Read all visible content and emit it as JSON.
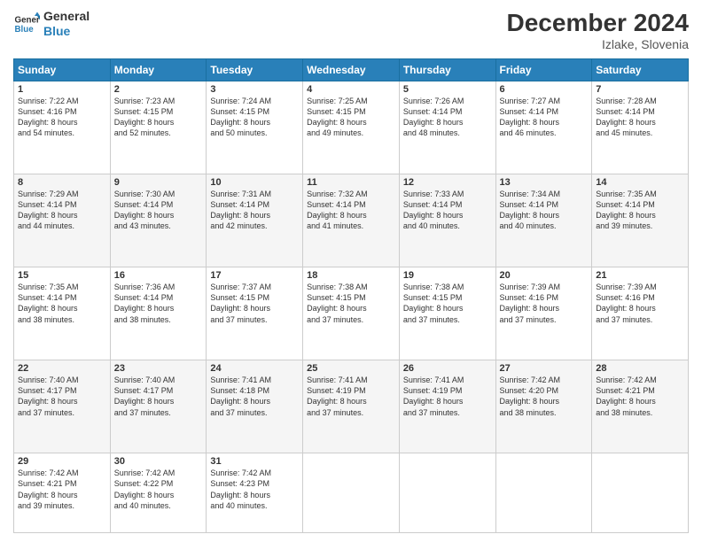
{
  "header": {
    "logo_line1": "General",
    "logo_line2": "Blue",
    "title": "December 2024",
    "subtitle": "Izlake, Slovenia"
  },
  "days_of_week": [
    "Sunday",
    "Monday",
    "Tuesday",
    "Wednesday",
    "Thursday",
    "Friday",
    "Saturday"
  ],
  "weeks": [
    [
      {
        "day": "1",
        "sunrise": "Sunrise: 7:22 AM",
        "sunset": "Sunset: 4:16 PM",
        "daylight": "Daylight: 8 hours and 54 minutes."
      },
      {
        "day": "2",
        "sunrise": "Sunrise: 7:23 AM",
        "sunset": "Sunset: 4:15 PM",
        "daylight": "Daylight: 8 hours and 52 minutes."
      },
      {
        "day": "3",
        "sunrise": "Sunrise: 7:24 AM",
        "sunset": "Sunset: 4:15 PM",
        "daylight": "Daylight: 8 hours and 50 minutes."
      },
      {
        "day": "4",
        "sunrise": "Sunrise: 7:25 AM",
        "sunset": "Sunset: 4:15 PM",
        "daylight": "Daylight: 8 hours and 49 minutes."
      },
      {
        "day": "5",
        "sunrise": "Sunrise: 7:26 AM",
        "sunset": "Sunset: 4:14 PM",
        "daylight": "Daylight: 8 hours and 48 minutes."
      },
      {
        "day": "6",
        "sunrise": "Sunrise: 7:27 AM",
        "sunset": "Sunset: 4:14 PM",
        "daylight": "Daylight: 8 hours and 46 minutes."
      },
      {
        "day": "7",
        "sunrise": "Sunrise: 7:28 AM",
        "sunset": "Sunset: 4:14 PM",
        "daylight": "Daylight: 8 hours and 45 minutes."
      }
    ],
    [
      {
        "day": "8",
        "sunrise": "Sunrise: 7:29 AM",
        "sunset": "Sunset: 4:14 PM",
        "daylight": "Daylight: 8 hours and 44 minutes."
      },
      {
        "day": "9",
        "sunrise": "Sunrise: 7:30 AM",
        "sunset": "Sunset: 4:14 PM",
        "daylight": "Daylight: 8 hours and 43 minutes."
      },
      {
        "day": "10",
        "sunrise": "Sunrise: 7:31 AM",
        "sunset": "Sunset: 4:14 PM",
        "daylight": "Daylight: 8 hours and 42 minutes."
      },
      {
        "day": "11",
        "sunrise": "Sunrise: 7:32 AM",
        "sunset": "Sunset: 4:14 PM",
        "daylight": "Daylight: 8 hours and 41 minutes."
      },
      {
        "day": "12",
        "sunrise": "Sunrise: 7:33 AM",
        "sunset": "Sunset: 4:14 PM",
        "daylight": "Daylight: 8 hours and 40 minutes."
      },
      {
        "day": "13",
        "sunrise": "Sunrise: 7:34 AM",
        "sunset": "Sunset: 4:14 PM",
        "daylight": "Daylight: 8 hours and 40 minutes."
      },
      {
        "day": "14",
        "sunrise": "Sunrise: 7:35 AM",
        "sunset": "Sunset: 4:14 PM",
        "daylight": "Daylight: 8 hours and 39 minutes."
      }
    ],
    [
      {
        "day": "15",
        "sunrise": "Sunrise: 7:35 AM",
        "sunset": "Sunset: 4:14 PM",
        "daylight": "Daylight: 8 hours and 38 minutes."
      },
      {
        "day": "16",
        "sunrise": "Sunrise: 7:36 AM",
        "sunset": "Sunset: 4:14 PM",
        "daylight": "Daylight: 8 hours and 38 minutes."
      },
      {
        "day": "17",
        "sunrise": "Sunrise: 7:37 AM",
        "sunset": "Sunset: 4:15 PM",
        "daylight": "Daylight: 8 hours and 37 minutes."
      },
      {
        "day": "18",
        "sunrise": "Sunrise: 7:38 AM",
        "sunset": "Sunset: 4:15 PM",
        "daylight": "Daylight: 8 hours and 37 minutes."
      },
      {
        "day": "19",
        "sunrise": "Sunrise: 7:38 AM",
        "sunset": "Sunset: 4:15 PM",
        "daylight": "Daylight: 8 hours and 37 minutes."
      },
      {
        "day": "20",
        "sunrise": "Sunrise: 7:39 AM",
        "sunset": "Sunset: 4:16 PM",
        "daylight": "Daylight: 8 hours and 37 minutes."
      },
      {
        "day": "21",
        "sunrise": "Sunrise: 7:39 AM",
        "sunset": "Sunset: 4:16 PM",
        "daylight": "Daylight: 8 hours and 37 minutes."
      }
    ],
    [
      {
        "day": "22",
        "sunrise": "Sunrise: 7:40 AM",
        "sunset": "Sunset: 4:17 PM",
        "daylight": "Daylight: 8 hours and 37 minutes."
      },
      {
        "day": "23",
        "sunrise": "Sunrise: 7:40 AM",
        "sunset": "Sunset: 4:17 PM",
        "daylight": "Daylight: 8 hours and 37 minutes."
      },
      {
        "day": "24",
        "sunrise": "Sunrise: 7:41 AM",
        "sunset": "Sunset: 4:18 PM",
        "daylight": "Daylight: 8 hours and 37 minutes."
      },
      {
        "day": "25",
        "sunrise": "Sunrise: 7:41 AM",
        "sunset": "Sunset: 4:19 PM",
        "daylight": "Daylight: 8 hours and 37 minutes."
      },
      {
        "day": "26",
        "sunrise": "Sunrise: 7:41 AM",
        "sunset": "Sunset: 4:19 PM",
        "daylight": "Daylight: 8 hours and 37 minutes."
      },
      {
        "day": "27",
        "sunrise": "Sunrise: 7:42 AM",
        "sunset": "Sunset: 4:20 PM",
        "daylight": "Daylight: 8 hours and 38 minutes."
      },
      {
        "day": "28",
        "sunrise": "Sunrise: 7:42 AM",
        "sunset": "Sunset: 4:21 PM",
        "daylight": "Daylight: 8 hours and 38 minutes."
      }
    ],
    [
      {
        "day": "29",
        "sunrise": "Sunrise: 7:42 AM",
        "sunset": "Sunset: 4:21 PM",
        "daylight": "Daylight: 8 hours and 39 minutes."
      },
      {
        "day": "30",
        "sunrise": "Sunrise: 7:42 AM",
        "sunset": "Sunset: 4:22 PM",
        "daylight": "Daylight: 8 hours and 40 minutes."
      },
      {
        "day": "31",
        "sunrise": "Sunrise: 7:42 AM",
        "sunset": "Sunset: 4:23 PM",
        "daylight": "Daylight: 8 hours and 40 minutes."
      },
      null,
      null,
      null,
      null
    ]
  ]
}
